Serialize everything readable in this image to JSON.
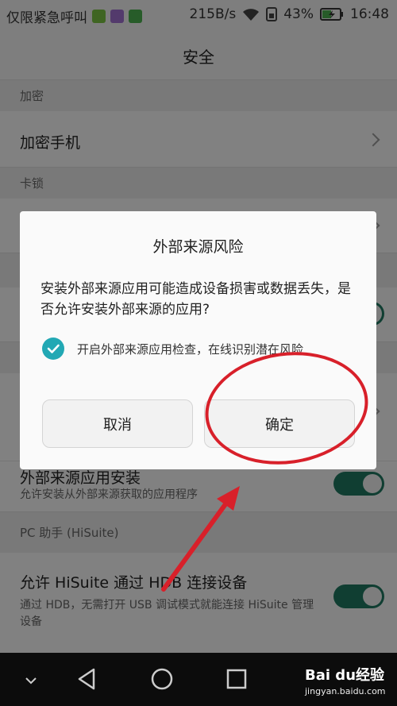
{
  "status_bar": {
    "carrier_text": "仅限紧急呼叫",
    "net_speed": "215B/s",
    "battery_percent": "43%",
    "time": "16:48"
  },
  "title_bar": {
    "title": "安全"
  },
  "settings": {
    "encrypt_header": "加密",
    "encrypt_phone": "加密手机",
    "card_lock_header": "卡锁",
    "external_install_title": "外部来源应用安装",
    "external_install_sub": "允许安装从外部来源获取的应用程序",
    "hisuite_header": "PC 助手 (HiSuite)",
    "hisuite_title": "允许 HiSuite 通过 HDB 连接设备",
    "hisuite_sub": "通过 HDB，无需打开 USB 调试模式就能连接 HiSuite 管理设备"
  },
  "dialog": {
    "title": "外部来源风险",
    "message": "安装外部来源应用可能造成设备损害或数据丢失，是否允许安装外部来源的应用?",
    "checkbox_label": "开启外部来源应用检查，在线识别潜在风险",
    "checkbox_checked": true,
    "cancel_label": "取消",
    "ok_label": "确定"
  },
  "watermark": {
    "brand": "Bai du经验",
    "url": "jingyan.baidu.com"
  },
  "colors": {
    "toggle_on": "#207860",
    "check_accent": "#22a8b4",
    "annotation_red": "#d8202a"
  },
  "icons": [
    "wifi-icon",
    "sim-icon",
    "battery-icon",
    "chevron-right-icon",
    "check-icon",
    "back-icon",
    "home-icon",
    "recents-icon",
    "collapse-icon"
  ]
}
